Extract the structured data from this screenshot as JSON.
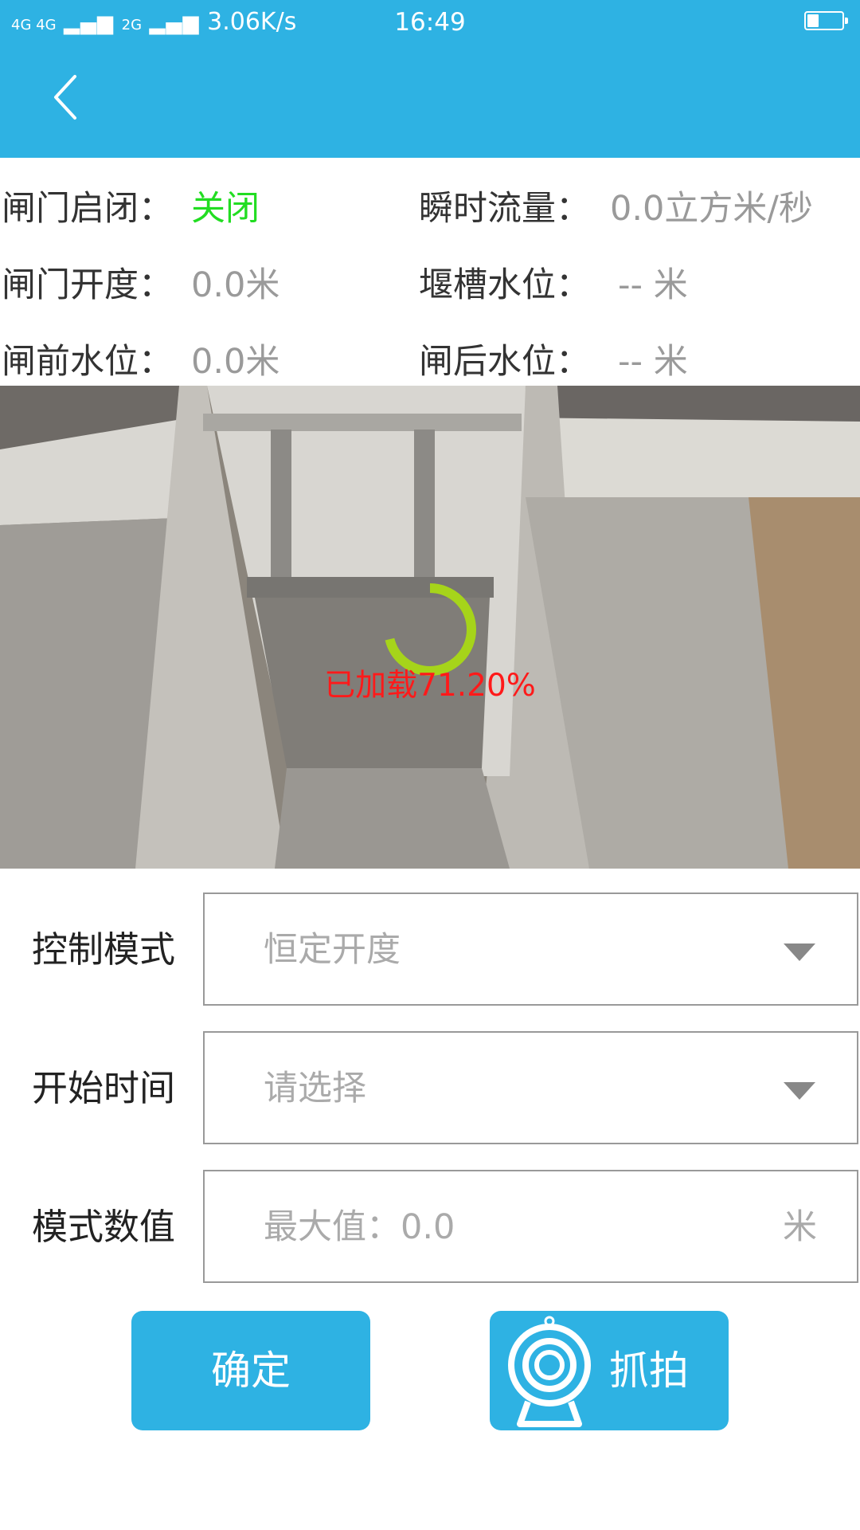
{
  "status": {
    "network": "4G 4G",
    "network2": "2G",
    "speed": "3.06K/s",
    "time": "16:49"
  },
  "header": {
    "back_icon": "chevron-left-icon"
  },
  "info": {
    "gate_state_label": "闸门启闭：",
    "gate_state_value": "关闭",
    "flow_label": "瞬时流量：",
    "flow_value": "0.0立方米/秒",
    "opening_label": "闸门开度：",
    "opening_value": "0.0米",
    "weir_label": "堰槽水位：",
    "weir_value": "-- 米",
    "front_level_label": "闸前水位：",
    "front_level_value": "0.0米",
    "back_level_label": "闸后水位：",
    "back_level_value": "-- 米"
  },
  "camera": {
    "loading_text": "已加载71.20%",
    "progress_fraction": 0.712
  },
  "form": {
    "mode_label": "控制模式",
    "mode_value": "恒定开度",
    "start_label": "开始时间",
    "start_placeholder": "请选择",
    "value_label": "模式数值",
    "value_placeholder": "最大值：0.0",
    "value_unit": "米"
  },
  "buttons": {
    "confirm": "确定",
    "snapshot": "抓拍",
    "snapshot_icon": "webcam-icon"
  },
  "colors": {
    "accent": "#2eb2e3",
    "gate_closed": "#22dd22",
    "loading_text": "#ff1a1a",
    "spinner": "#a6d41a"
  }
}
